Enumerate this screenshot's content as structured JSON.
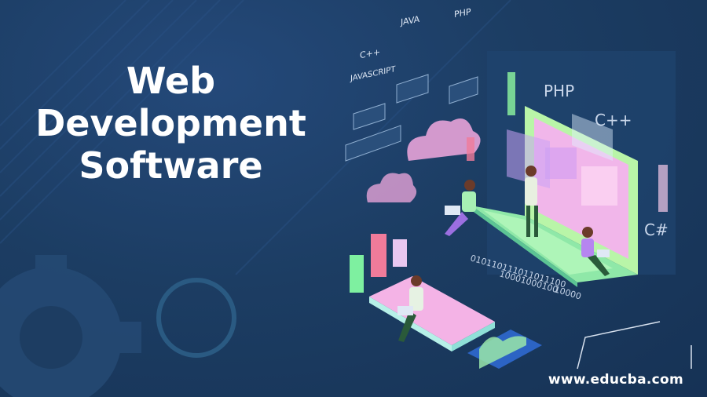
{
  "headline": {
    "line1": "Web",
    "line2": "Development",
    "line3": "Software"
  },
  "tags": {
    "cpp": "C++",
    "java": "JAVA",
    "php": "PHP",
    "javascript": "JAVASCRIPT"
  },
  "screen_labels": {
    "php": "PHP",
    "cpp": "C++",
    "csharp": "C#"
  },
  "binary": {
    "line1": "010110111011011100",
    "line2": "10001000100",
    "line3": "10000"
  },
  "footer": {
    "url": "www.educba.com"
  },
  "colors": {
    "background": "#1c3d63",
    "accent_green": "#b9f5a8",
    "accent_pink": "#f4b3e6",
    "text": "#ffffff"
  }
}
